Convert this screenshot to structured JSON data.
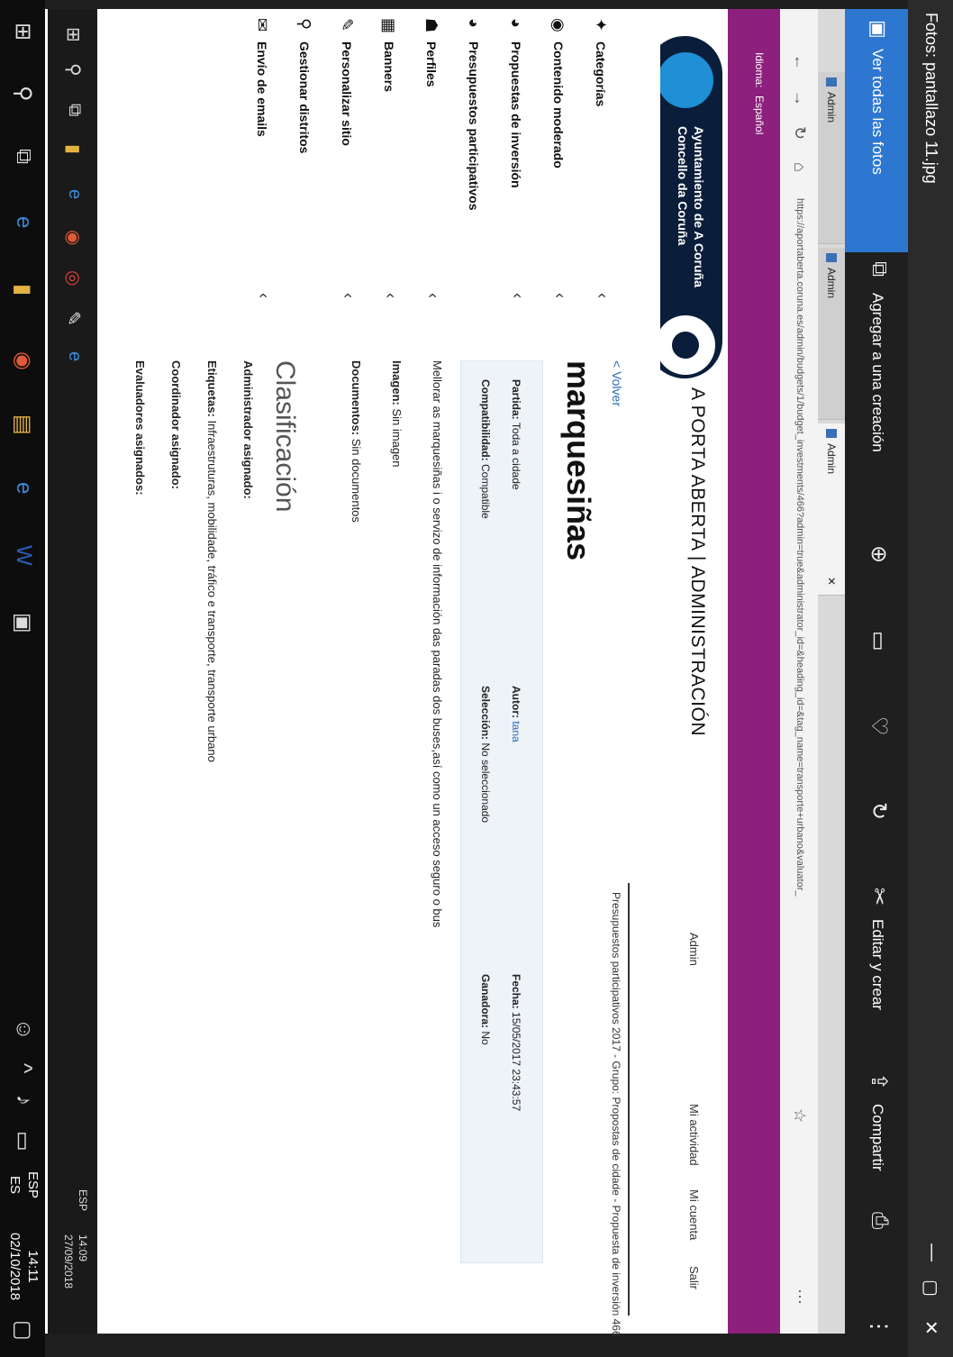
{
  "window": {
    "title": "Fotos: pantallazo 11.jpg",
    "minimize": "—",
    "maximize": "▢",
    "close": "✕"
  },
  "photos_toolbar": {
    "see_all": "Ver todas las fotos",
    "add_to_creation": "Agregar a una creación",
    "edit_create": "Editar y crear",
    "share": "Compartir"
  },
  "browser": {
    "tabs": [
      {
        "label": "Admin"
      },
      {
        "label": "Admin"
      },
      {
        "label": "Admin"
      }
    ],
    "url": "https://aportaberta.coruna.es/admin/budgets/1/budget_investments/466?admin=true&administrator_id=&heading_id=&tag_name=transporte+urbano&valuator_"
  },
  "site": {
    "language_label": "Idioma:",
    "language_value": "Español",
    "org_line1": "Ayuntamiento de A Coruña",
    "org_line2": "Concello da Coruña",
    "title": "A PORTA ABERTA | ADMINISTRACIÓN",
    "nav": {
      "admin": "Admin",
      "activity": "Mi actividad",
      "account": "Mi cuenta",
      "logout": "Salir"
    }
  },
  "sidebar": {
    "items": [
      {
        "label": "Categorías",
        "icon": "tag-icon"
      },
      {
        "label": "Contenido moderado",
        "icon": "eye-icon"
      },
      {
        "label": "Propuestas de inversión",
        "icon": "pie-icon"
      },
      {
        "label": "Presupuestos participativos",
        "icon": "pie-icon"
      },
      {
        "label": "Perfiles",
        "icon": "users-icon"
      },
      {
        "label": "Banners",
        "icon": "grid-icon"
      },
      {
        "label": "Personalizar sitio",
        "icon": "pencil-icon"
      },
      {
        "label": "Gestionar distritos",
        "icon": "pin-icon"
      },
      {
        "label": "Envío de emails",
        "icon": "mail-icon"
      }
    ]
  },
  "content": {
    "back": "< Volver",
    "breadcrumb": "Presupuestos participativos 2017 - Grupo: Propostas de cidade - Propuesta de inversión 466",
    "title": "marquesiñas",
    "partida_label": "Partida:",
    "partida_value": "Toda a cidade",
    "autor_label": "Autor:",
    "autor_value": "tana",
    "fecha_label": "Fecha:",
    "fecha_value": "15/05/2017 23:43:57",
    "compat_label": "Compatibilidad:",
    "compat_value": "Compatible",
    "seleccion_label": "Selección:",
    "seleccion_value": "No seleccionado",
    "ganadora_label": "Ganadora:",
    "ganadora_value": "No",
    "description": "Mellorar as marquesiñas i o servizo de información das paradas dos buses,así como un acceso seguro o bus",
    "imagen_label": "Imagen:",
    "imagen_value": "Sin imagen",
    "documentos_label": "Documentos:",
    "documentos_value": "Sin documentos",
    "clasificacion": "Clasificación",
    "admin_asignado": "Administrador asignado:",
    "etiquetas_label": "Etiquetas:",
    "etiquetas_value": "Infraestruturas, mobilidade, tráfico e transporte, transporte urbano",
    "coordinador": "Coordinador asignado:",
    "evaluadores": "Evaluadores asignados:"
  },
  "inner_taskbar": {
    "time": "14:09",
    "date": "27/09/2018",
    "lang": "ESP"
  },
  "taskbar": {
    "lang_top": "ESP",
    "lang_bottom": "ES",
    "time": "14:11",
    "date": "02/10/2018"
  }
}
